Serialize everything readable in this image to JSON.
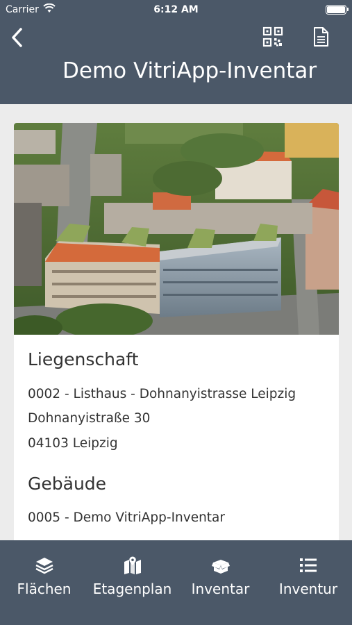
{
  "status_bar": {
    "carrier": "Carrier",
    "time": "6:12 AM"
  },
  "header": {
    "title": "Demo VitriApp-Inventar",
    "back_icon": "chevron-left-icon",
    "qr_icon": "qr-code-icon",
    "doc_icon": "document-icon"
  },
  "property": {
    "heading": "Liegenschaft",
    "lines": [
      "0002 - Listhaus - Dohnanyistrasse Leipzig",
      "Dohnanyistraße 30",
      "04103 Leipzig"
    ]
  },
  "building": {
    "heading": "Gebäude",
    "lines": [
      "0005 - Demo VitriApp-Inventar"
    ]
  },
  "tabs": [
    {
      "label": "Flächen",
      "icon": "layers-icon"
    },
    {
      "label": "Etagenplan",
      "icon": "map-icon"
    },
    {
      "label": "Inventar",
      "icon": "box-icon"
    },
    {
      "label": "Inventur",
      "icon": "list-icon"
    }
  ],
  "colors": {
    "header_bg": "#4b5868",
    "page_bg": "#ececec",
    "card_bg": "#ffffff",
    "text": "#333333"
  }
}
